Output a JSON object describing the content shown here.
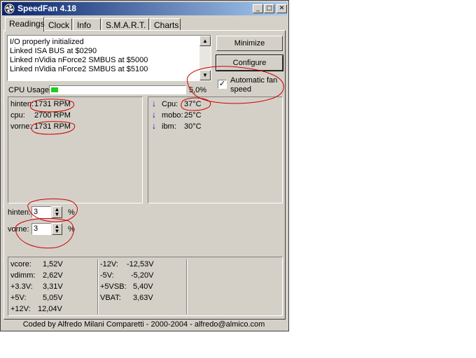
{
  "window": {
    "title": "SpeedFan 4.18"
  },
  "tabs": [
    "Readings",
    "Clock",
    "Info",
    "S.M.A.R.T.",
    "Charts"
  ],
  "log": [
    "I/O properly initialized",
    "Linked ISA BUS at $0290",
    "Linked nVidia nForce2 SMBUS at $5000",
    "Linked nVidia nForce2 SMBUS at $5100"
  ],
  "buttons": {
    "minimize": "Minimize",
    "configure": "Configure"
  },
  "cpu_usage": {
    "label": "CPU Usage",
    "value": "5,0%",
    "fraction": 0.05
  },
  "auto_fan": {
    "label": "Automatic fan speed",
    "checked": true
  },
  "fans": [
    {
      "name": "hinten:",
      "value": "1731 RPM"
    },
    {
      "name": "cpu:",
      "value": "2700 RPM"
    },
    {
      "name": "vorne:",
      "value": "1731 RPM"
    }
  ],
  "temps": [
    {
      "name": "Cpu:",
      "value": "37°C"
    },
    {
      "name": "mobo:",
      "value": "25°C"
    },
    {
      "name": "ibm:",
      "value": "30°C"
    }
  ],
  "speeds": [
    {
      "name": "hinten:",
      "value": "3",
      "unit": "%"
    },
    {
      "name": "vorne:",
      "value": "3",
      "unit": "%"
    }
  ],
  "voltages_left": [
    {
      "name": "vcore:",
      "value": "1,52V"
    },
    {
      "name": "vdimm:",
      "value": "2,62V"
    },
    {
      "name": "+3.3V:",
      "value": "3,31V"
    },
    {
      "name": "+5V:",
      "value": "5,05V"
    },
    {
      "name": "+12V:",
      "value": "12,04V"
    }
  ],
  "voltages_right": [
    {
      "name": "-12V:",
      "value": "-12,53V"
    },
    {
      "name": "-5V:",
      "value": "-5,20V"
    },
    {
      "name": "+5VSB:",
      "value": "5,40V"
    },
    {
      "name": "VBAT:",
      "value": "3,63V"
    }
  ],
  "status": "Coded by Alfredo Milani Comparetti - 2000-2004 - alfredo@almico.com",
  "colors": {
    "annotation": "#cc0000",
    "titlebar_start": "#0a246a",
    "arrow": "#0000cc"
  }
}
